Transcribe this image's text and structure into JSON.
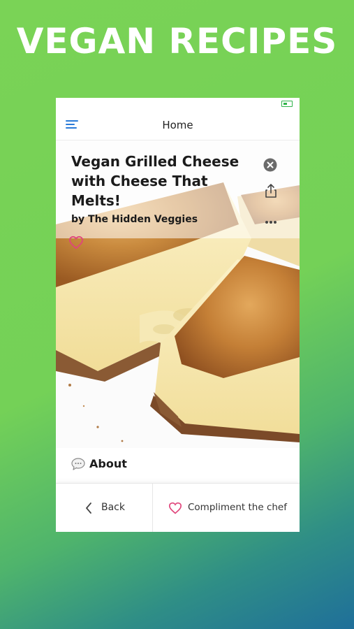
{
  "promo": {
    "title": "VEGAN RECIPES"
  },
  "navbar": {
    "title": "Home",
    "menu_icon": "hamburger-menu-icon"
  },
  "recipe": {
    "title": "Vegan Grilled Cheese with Cheese That Melts!",
    "author": "by The Hidden Veggies"
  },
  "about": {
    "label": "About",
    "icon": "speech-bubble-icon"
  },
  "bottom_bar": {
    "back_label": "Back",
    "compliment_label": "Compliment the chef"
  },
  "colors": {
    "accent_blue": "#2a7bd8",
    "heart_pink": "#e0457b",
    "background_green": "#74d157",
    "background_blue": "#1f6f9a"
  }
}
